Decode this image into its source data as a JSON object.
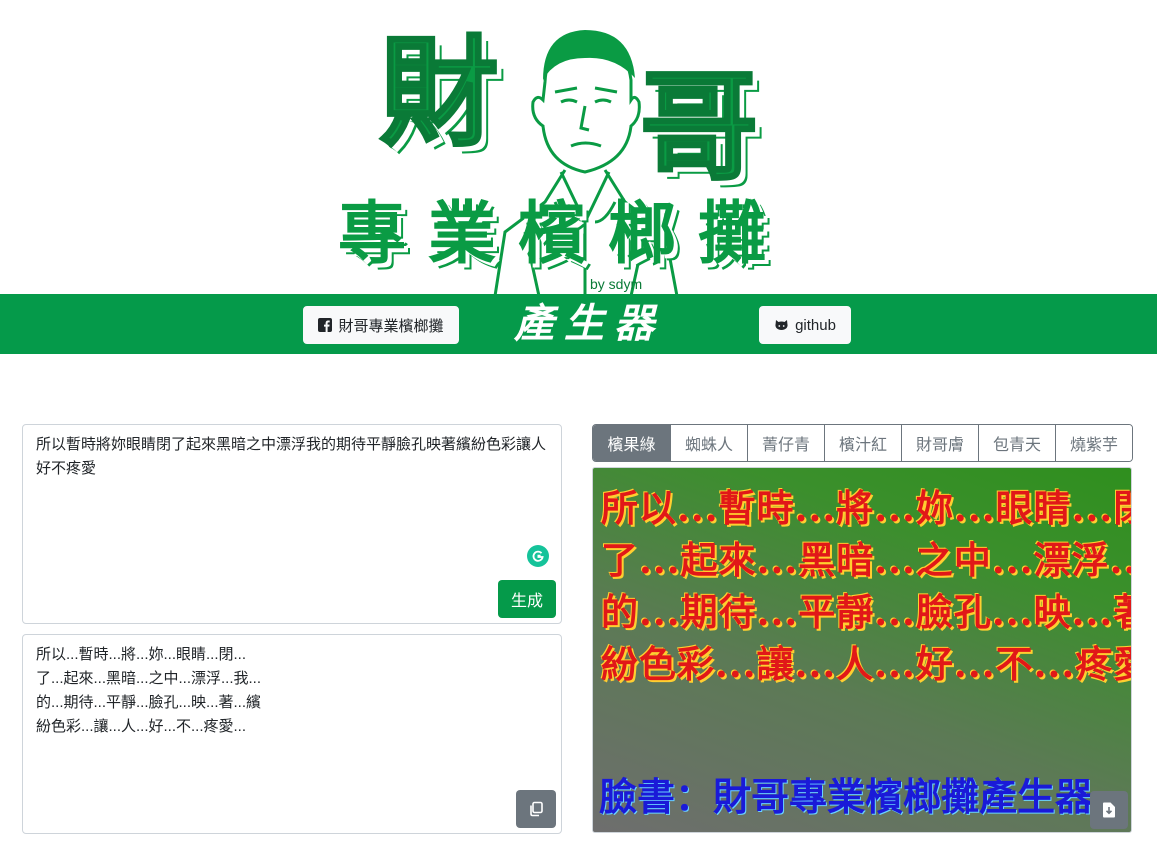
{
  "logo": {
    "char_left": "財",
    "char_right": "哥",
    "subtitle": "專業檳榔攤",
    "byline": "by sdym"
  },
  "navbar": {
    "facebook_label": "財哥專業檳榔攤",
    "title": "產生器",
    "github_label": "github"
  },
  "input": {
    "text": "所以暫時將妳眼睛閉了起來黑暗之中漂浮我的期待平靜臉孔映著繽紛色彩讓人好不疼愛",
    "generate_label": "生成"
  },
  "output": {
    "text": "所以...暫時...將...妳...眼睛...閉...\n了...起來...黑暗...之中...漂浮...我...\n的...期待...平靜...臉孔...映...著...繽\n紛色彩...讓...人...好...不...疼愛..."
  },
  "tabs": [
    {
      "label": "檳果綠",
      "active": true
    },
    {
      "label": "蜘蛛人",
      "active": false
    },
    {
      "label": "菁仔青",
      "active": false
    },
    {
      "label": "檳汁紅",
      "active": false
    },
    {
      "label": "財哥膚",
      "active": false
    },
    {
      "label": "包青天",
      "active": false
    },
    {
      "label": "燒紫芋",
      "active": false
    }
  ],
  "preview": {
    "lines": [
      "所以...暫時...將...妳...眼睛...閉...",
      "了...起來...黑暗...之中...漂浮...我...",
      "的...期待...平靜...臉孔...映...著...繽",
      "紛色彩...讓...人...好...不...疼愛..."
    ],
    "footer": "臉書：財哥專業檳榔攤產生器"
  },
  "icons": {
    "facebook": "facebook-icon",
    "github": "github-icon",
    "grammarly": "grammarly-icon",
    "copy": "copy-icon",
    "download": "download-icon"
  },
  "colors": {
    "brand_green": "#059a4a",
    "tab_gray": "#6c757d",
    "preview_text_red": "#e11818",
    "preview_footer_blue": "#1a1ad8"
  }
}
